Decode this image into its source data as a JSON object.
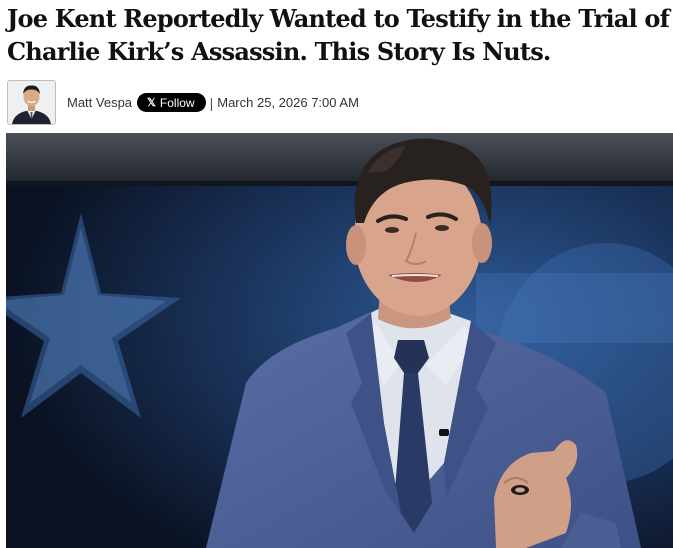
{
  "article": {
    "headline_line1": "Joe Kent Reportedly Wanted to Testify in the Trial of",
    "headline_line2": "Charlie Kirk’s Assassin. This Story Is Nuts.",
    "author": "Matt Vespa",
    "follow_label": "Follow",
    "separator": "|",
    "date": "March 25, 2026 7:00 AM"
  },
  "icons": {
    "follow": "x-logo-icon",
    "avatar": "author-portrait"
  },
  "colors": {
    "follow_button_bg": "#000000",
    "headline": "#111111",
    "suit": "#4a5f94"
  }
}
